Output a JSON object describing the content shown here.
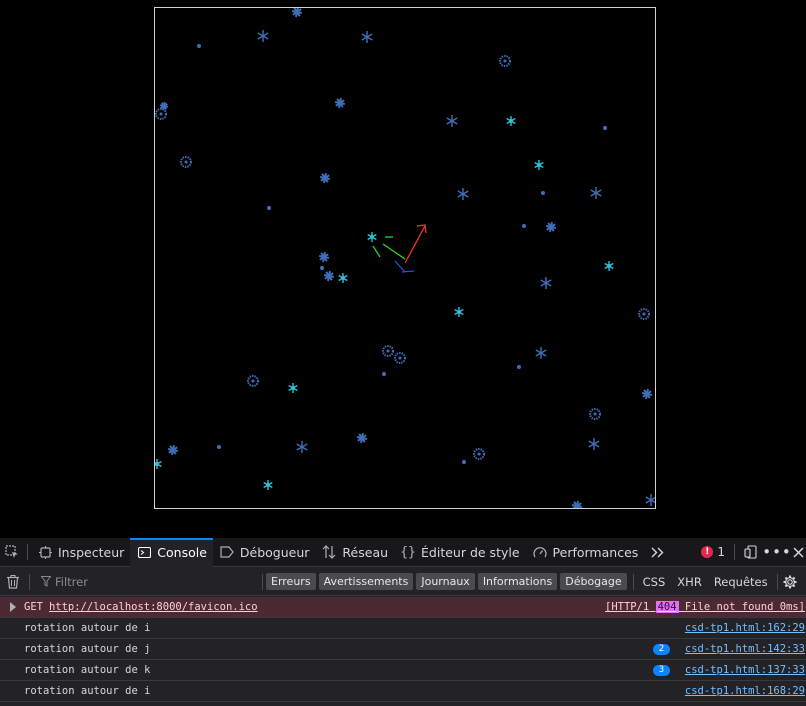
{
  "devtools": {
    "tabs": [
      {
        "id": "inspector",
        "label": "Inspecteur",
        "icon": "inspector-icon"
      },
      {
        "id": "console",
        "label": "Console",
        "icon": "console-icon",
        "active": true
      },
      {
        "id": "debugger",
        "label": "Débogueur",
        "icon": "debugger-icon"
      },
      {
        "id": "network",
        "label": "Réseau",
        "icon": "network-icon"
      },
      {
        "id": "style-editor",
        "label": "Éditeur de style",
        "icon": "braces-icon"
      },
      {
        "id": "performance",
        "label": "Performances",
        "icon": "gauge-icon"
      }
    ],
    "error_count": "1",
    "filter": {
      "placeholder": "Filtrer",
      "levels": [
        "Erreurs",
        "Avertissements",
        "Journaux",
        "Informations",
        "Débogage"
      ],
      "types": [
        "CSS",
        "XHR",
        "Requêtes"
      ]
    },
    "messages": [
      {
        "type": "error",
        "method": "GET",
        "url": "http://localhost:8000/favicon.ico",
        "http_version": "[HTTP/1",
        "status_code": "404",
        "status_text": "File not found 0ms]"
      },
      {
        "type": "log",
        "text": "rotation autour de i",
        "count": "",
        "source": "csd-tp1.html:162:29"
      },
      {
        "type": "log",
        "text": "rotation autour de j",
        "count": "2",
        "source": "csd-tp1.html:142:33"
      },
      {
        "type": "log",
        "text": "rotation autour de k",
        "count": "3",
        "source": "csd-tp1.html:137:33"
      },
      {
        "type": "log",
        "text": "rotation autour de i",
        "count": "",
        "source": "csd-tp1.html:168:29"
      }
    ]
  },
  "colors": {
    "canvas_bg": "#000000",
    "flake_blue": "#3f6fb8",
    "flake_cyan": "#2fc0d8",
    "axis_x": "#e83a2a",
    "axis_y": "#2ad42a",
    "axis_z": "#2a4ee8",
    "accent": "#0a84ff",
    "error_bg": "#4b2a33"
  }
}
